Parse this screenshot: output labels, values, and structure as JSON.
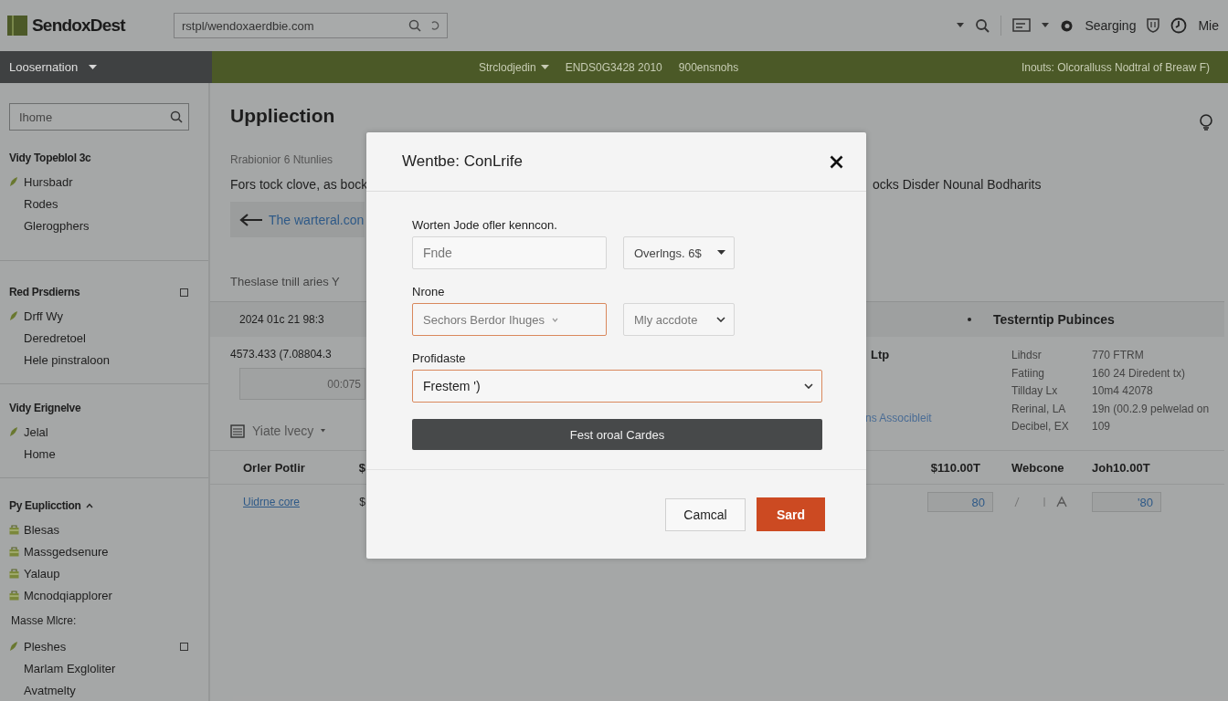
{
  "header": {
    "logo": "SendoxDest",
    "url": "rstpl/wendoxaerdbie.com",
    "status_label": "Searging",
    "user_label": "Mie"
  },
  "nav": {
    "menu": "Loosernation",
    "items": [
      {
        "label": "Strclodjedin",
        "dropdown": true
      },
      {
        "label": "ENDS0G3428 2010",
        "dropdown": false
      },
      {
        "label": "900ensnohs",
        "dropdown": false
      }
    ],
    "notice": "Inouts: Olcoralluss Nodtral of Breaw F)"
  },
  "sidebar": {
    "search": {
      "value": "Ihome"
    },
    "sections": [
      {
        "title": "Vidy Topeblol 3c",
        "items": [
          {
            "label": "Hursbadr",
            "kind": "leaf"
          },
          {
            "label": "Rodes",
            "kind": "plain"
          },
          {
            "label": "Glerogphers",
            "kind": "plain"
          }
        ]
      },
      {
        "title": "Red Prsdierns",
        "checked": false,
        "items": [
          {
            "label": "Drff Wy",
            "kind": "leaf"
          },
          {
            "label": "Deredretoel",
            "kind": "plain"
          },
          {
            "label": "Hele pinstraloon",
            "kind": "plain"
          }
        ]
      },
      {
        "title": "Vidy Erignelve",
        "items": [
          {
            "label": "Jelal",
            "kind": "leaf"
          },
          {
            "label": "Home",
            "kind": "plain"
          }
        ]
      },
      {
        "title": "Py Euplicction",
        "expanded": true,
        "items": [
          {
            "label": "Blesas",
            "kind": "bag"
          },
          {
            "label": "Massgedsenure",
            "kind": "bag"
          },
          {
            "label": "Yalaup",
            "kind": "bag"
          },
          {
            "label": "Mcnodqiapplorer",
            "kind": "bag"
          },
          {
            "label": "Masse Mlcre:",
            "kind": "subheading"
          },
          {
            "label": "Pleshes",
            "kind": "leaf",
            "checked": false
          },
          {
            "label": "Marlam Exgloliter",
            "kind": "plain"
          },
          {
            "label": "Avatmelty",
            "kind": "plain"
          }
        ]
      }
    ]
  },
  "main": {
    "title": "Uppliection",
    "subtitle": "Rrabionior 6 Ntunlies",
    "intro_left": "Fors tock clove, as bock",
    "intro_right": "ocks Disder Nounal Bodharits",
    "banner_link": "The warteral.con",
    "caption": "Theslase tnill aries Y",
    "summary_left": "2024 01c 21 98:3",
    "summary_title": "Testerntip Pubinces",
    "amount": "4573.433 (7.08804.3",
    "badge": "Ltp",
    "link_right": "ns Associbleit",
    "time_box": "00:075",
    "view_menu": "Yiate lvecy",
    "details": [
      {
        "key": "Lihdsr",
        "value": "770 FTRM"
      },
      {
        "key": "Fatiing",
        "value": "160 24 Diredent tx)"
      },
      {
        "key": "Tillday Lx",
        "value": "10m4 42078"
      },
      {
        "key": "Rerinal, LA",
        "value": "19n (00.2.9 pelwelad on"
      },
      {
        "key": "Decibel, EX",
        "value": "109"
      }
    ],
    "table": {
      "columns": [
        "Orler Potlir",
        "$",
        "$110.00T",
        "Webcone",
        "Joh10.00T"
      ],
      "row": {
        "link": "Uidrne core",
        "column_2": "$",
        "input_1": "80",
        "input_2": "'80"
      }
    }
  },
  "modal": {
    "title": "Wentbe: ConLrife",
    "label_1": "Worten Jode ofler kenncon.",
    "input_placeholder": "Fnde",
    "select_1": "Overlngs.  6$",
    "label_2": "Nrone",
    "select_2": {
      "value": "Sechors Berdor Ihuges",
      "highlighted": true
    },
    "select_3": {
      "value": "Mly accdote",
      "highlighted": false
    },
    "label_3": "Profidaste",
    "select_4": {
      "value": "Frestem ')",
      "highlighted": true
    },
    "action": "Fest oroal Cardes",
    "cancel": "Camcal",
    "submit": "Sard"
  }
}
